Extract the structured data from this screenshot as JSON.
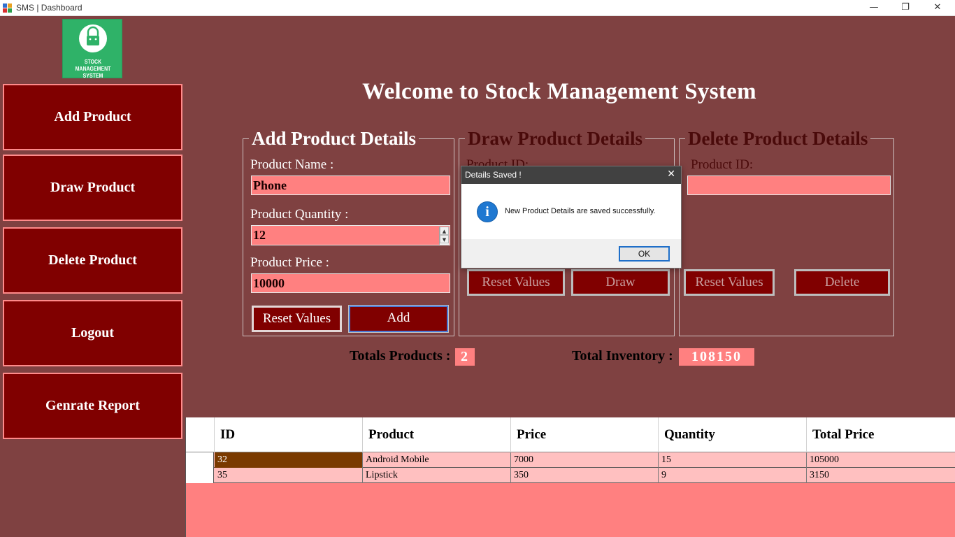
{
  "window": {
    "title": "SMS | Dashboard",
    "minimize_glyph": "—",
    "restore_glyph": "❐",
    "close_glyph": "✕"
  },
  "logo": {
    "caption_line1": "STOCK",
    "caption_line2": "MANAGEMENT SYSTEM"
  },
  "sidebar": {
    "items": [
      {
        "label": "Add Product"
      },
      {
        "label": "Draw Product"
      },
      {
        "label": "Delete Product"
      },
      {
        "label": "Logout"
      },
      {
        "label": "Genrate Report"
      }
    ]
  },
  "header": {
    "title": "Welcome to Stock Management System"
  },
  "add_panel": {
    "title": "Add Product Details",
    "name_label": "Product Name :",
    "name_value": "Phone",
    "quantity_label": "Product Quantity :",
    "quantity_value": "12",
    "price_label": "Product Price :",
    "price_value": "10000",
    "reset_label": "Reset Values",
    "add_label": "Add"
  },
  "draw_panel": {
    "title": "Draw Product Details",
    "id_label": "Product ID:",
    "reset_label": "Reset Values",
    "draw_label": "Draw"
  },
  "delete_panel": {
    "title": "Delete Product Details",
    "id_label": "Product ID:",
    "id_value": "",
    "reset_label": "Reset Values",
    "delete_label": "Delete"
  },
  "totals": {
    "products_label": "Totals Products :",
    "products_value": "2",
    "inventory_label": "Total Inventory :",
    "inventory_value": "108150"
  },
  "grid": {
    "columns": [
      "ID",
      "Product",
      "Price",
      "Quantity",
      "Total Price"
    ],
    "rows": [
      [
        "32",
        "Android Mobile",
        "7000",
        "15",
        "105000"
      ],
      [
        "35",
        "Lipstick",
        "350",
        "9",
        "3150"
      ]
    ]
  },
  "dialog": {
    "title": "Details Saved !",
    "close_glyph": "✕",
    "icon_glyph": "i",
    "message": "New Product Details are saved successfully.",
    "ok_label": "OK"
  },
  "colors": {
    "background": "#7f4141",
    "button": "#800000",
    "field": "#ff8080",
    "row": "#ffc0c0",
    "selected_cell": "#7a3a00",
    "logo": "#2fb268"
  }
}
